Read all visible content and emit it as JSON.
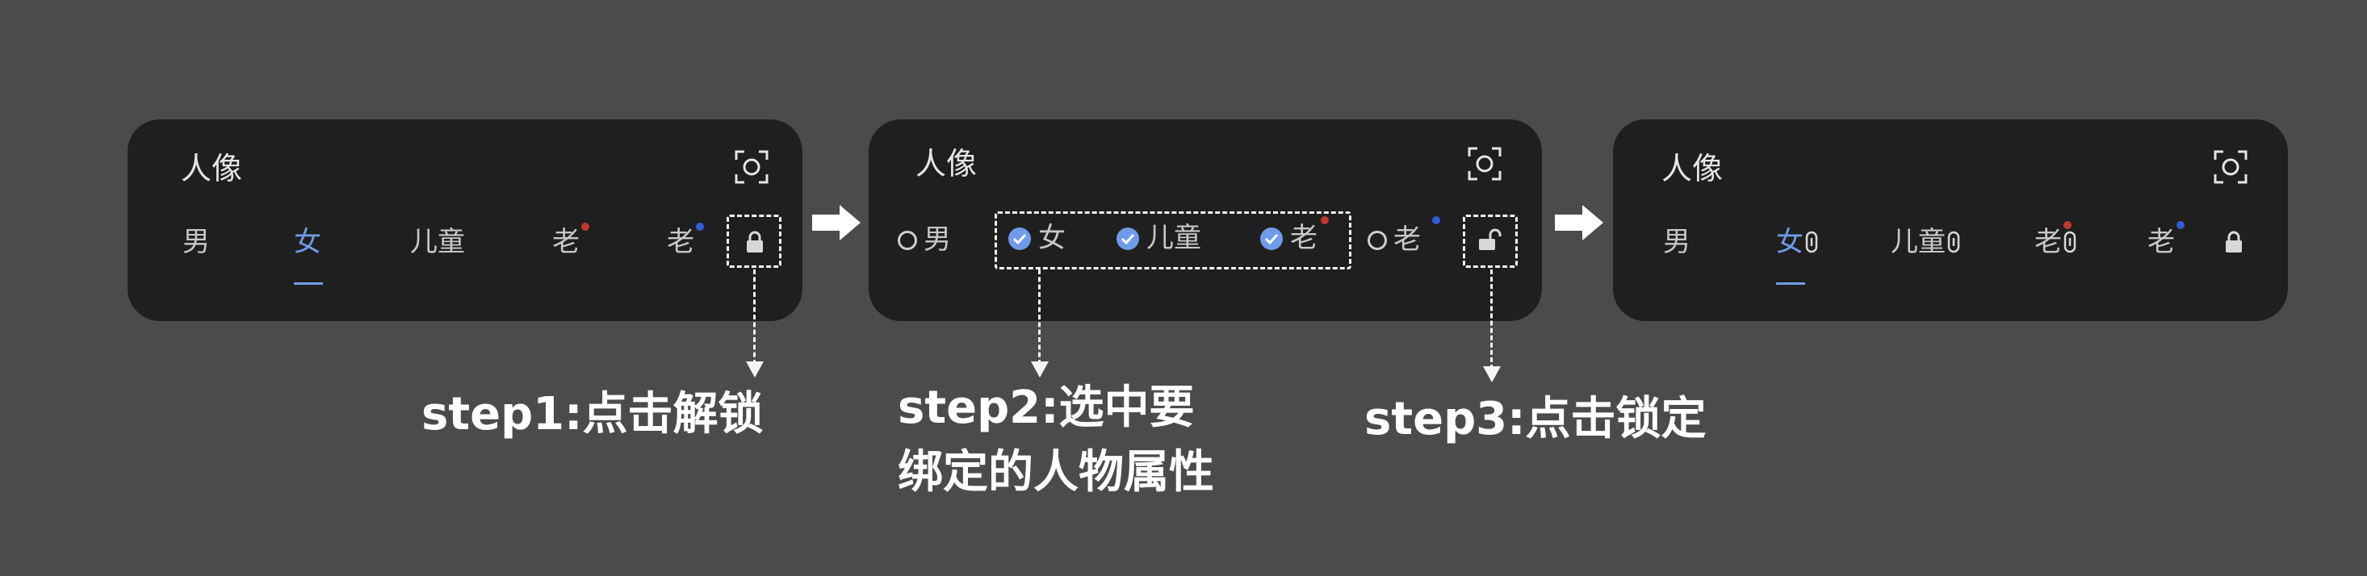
{
  "panels": [
    {
      "title": "人像",
      "tabs": [
        "男",
        "女",
        "儿童",
        "老",
        "老"
      ]
    },
    {
      "title": "人像",
      "tabs": [
        "男",
        "女",
        "儿童",
        "老",
        "老"
      ]
    },
    {
      "title": "人像",
      "tabs": [
        "男",
        "女",
        "儿童",
        "老",
        "老"
      ]
    }
  ],
  "steps": [
    {
      "label": "step1:点击解锁"
    },
    {
      "label_line1": "step2:选中要",
      "label_line2": "绑定的人物属性"
    },
    {
      "label": "step3:点击锁定"
    }
  ],
  "colors": {
    "background": "#4b4b4b",
    "card": "#1f1f1f",
    "accent": "#6f9bea",
    "dot_red": "#c0392b",
    "dot_blue": "#2f5ed6"
  },
  "icons": [
    "scan-icon",
    "lock-icon",
    "unlock-icon",
    "check-icon",
    "link-icon",
    "right-arrow-icon"
  ]
}
